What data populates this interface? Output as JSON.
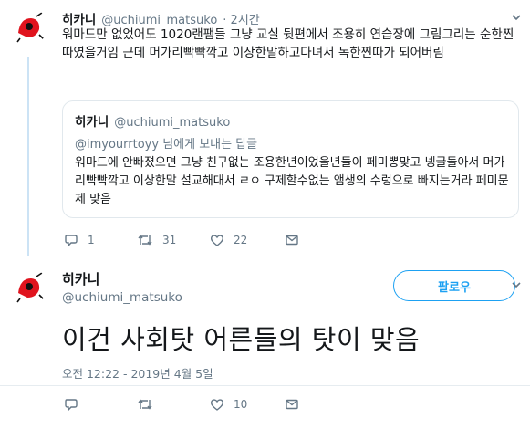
{
  "tweet1": {
    "name": "히카니",
    "handle": "@uchiumi_matsuko",
    "time": "· 2시간",
    "text": "워마드만 없었어도 1020랜팸들 그냥 교실 뒷편에서 조용히 연습장에 그림그리는 순한찐따였을거임 근데 머가리빡빡깍고 이상한말하고다녀서 독한찐따가 되어버림",
    "replies": "1",
    "retweets": "31",
    "likes": "22"
  },
  "quote": {
    "name": "히카니",
    "handle": "@uchiumi_matsuko",
    "reply_to_handle": "@imyourrtoyy",
    "reply_to_suffix": " 님에게 보내는 답글",
    "text": "워마드에 안빠졌으면 그냥 친구없는 조용한년이었을년들이 페미뽕맞고 넹글돌아서 머가리빡빡깍고 이상한말 설교해대서 ㄹㅇ 구제할수없는 앰생의 수렁으로 빠지는거라 페미문제 맞음"
  },
  "tweet2": {
    "name": "히카니",
    "handle": "@uchiumi_matsuko",
    "follow_label": "팔로우",
    "text": "이건 사회탓 어른들의 탓이 맞음",
    "timestamp": "오전 12:22 - 2019년 4월 5일",
    "likes": "10"
  },
  "colors": {
    "accent": "#1da1f2",
    "muted": "#657786",
    "border": "#e1e8ed",
    "thread": "#cce3f5"
  }
}
